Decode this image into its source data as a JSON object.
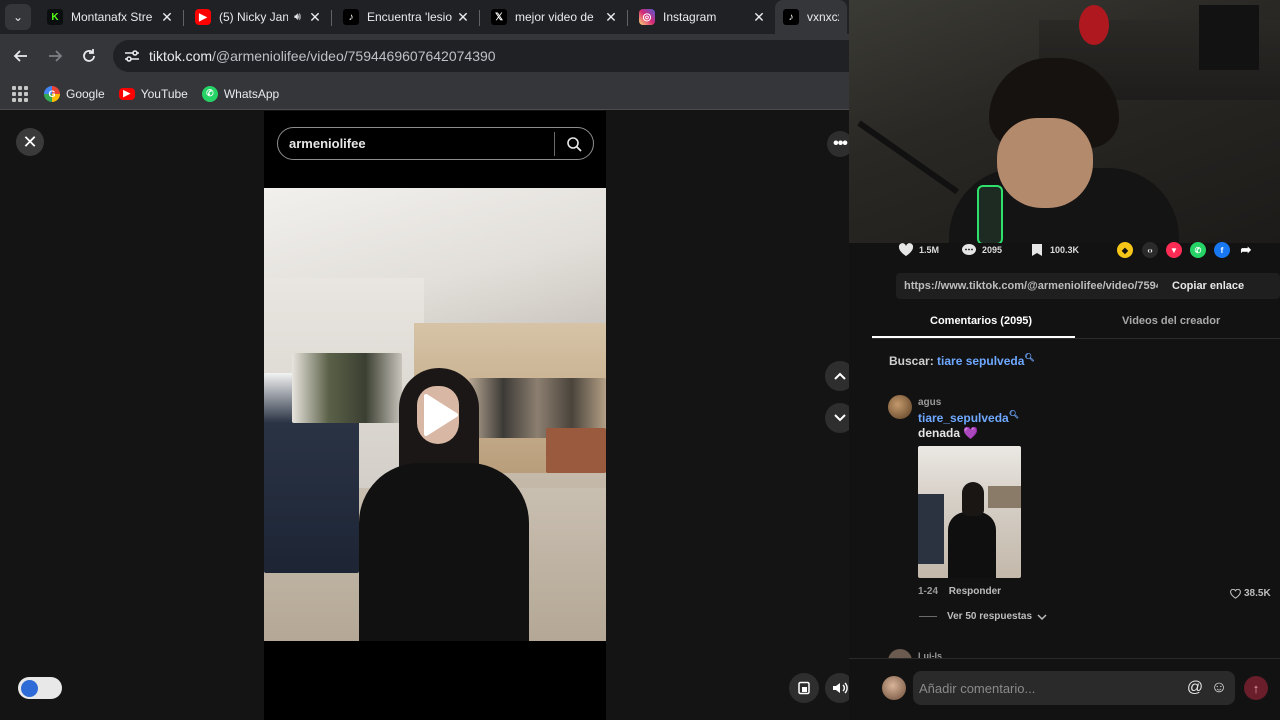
{
  "browser": {
    "tabs": [
      {
        "title": "Montanafx Stre",
        "favicon": "kick-icon",
        "color": "#53fc18",
        "active": false,
        "audio": false
      },
      {
        "title": "(5) Nicky Jan",
        "favicon": "youtube-icon",
        "color": "#ff0000",
        "active": false,
        "audio": true
      },
      {
        "title": "Encuentra 'lesio",
        "favicon": "tiktok-icon",
        "color": "#000000",
        "active": false,
        "audio": false
      },
      {
        "title": "mejor video de",
        "favicon": "x-icon",
        "color": "#000000",
        "active": false,
        "audio": false
      },
      {
        "title": "Instagram",
        "favicon": "instagram-icon",
        "color": "#d62976",
        "active": false,
        "audio": false
      },
      {
        "title": "vxnxcxo",
        "favicon": "tiktok-icon",
        "color": "#000000",
        "active": true,
        "audio": false
      }
    ],
    "url_domain": "tiktok.com",
    "url_path": "/@armeniolifee/video/7594469607642074390",
    "bookmarks": [
      {
        "label": "Google",
        "icon": "google-icon"
      },
      {
        "label": "YouTube",
        "icon": "youtube-icon"
      },
      {
        "label": "WhatsApp",
        "icon": "whatsapp-icon"
      }
    ]
  },
  "viewer": {
    "search_value": "armeniolifee",
    "close_icon": "close-icon",
    "more_icon": "more-icon"
  },
  "panel": {
    "likes": "1.5M",
    "comments": "2095",
    "saves": "100.3K",
    "share_link": "https://www.tiktok.com/@armeniolifee/video/7594...",
    "copy_label": "Copiar enlace",
    "tab_comments": "Comentarios (2095)",
    "tab_creator": "Videos del creador",
    "buscar_label": "Buscar:",
    "buscar_query": "tiare sepulveda",
    "comment": {
      "user": "agus",
      "mention": "tiare_sepulveda",
      "text": "denada",
      "emoji": "💜",
      "date": "1-24",
      "reply_label": "Responder",
      "likes": "38.5K",
      "replies_label": "Ver 50 respuestas"
    },
    "next_user": "Lui-Is",
    "input_placeholder": "Añadir comentario..."
  },
  "colors": {
    "accent_blue": "#6ea8ff",
    "tiktok_red": "#fe2c55"
  }
}
